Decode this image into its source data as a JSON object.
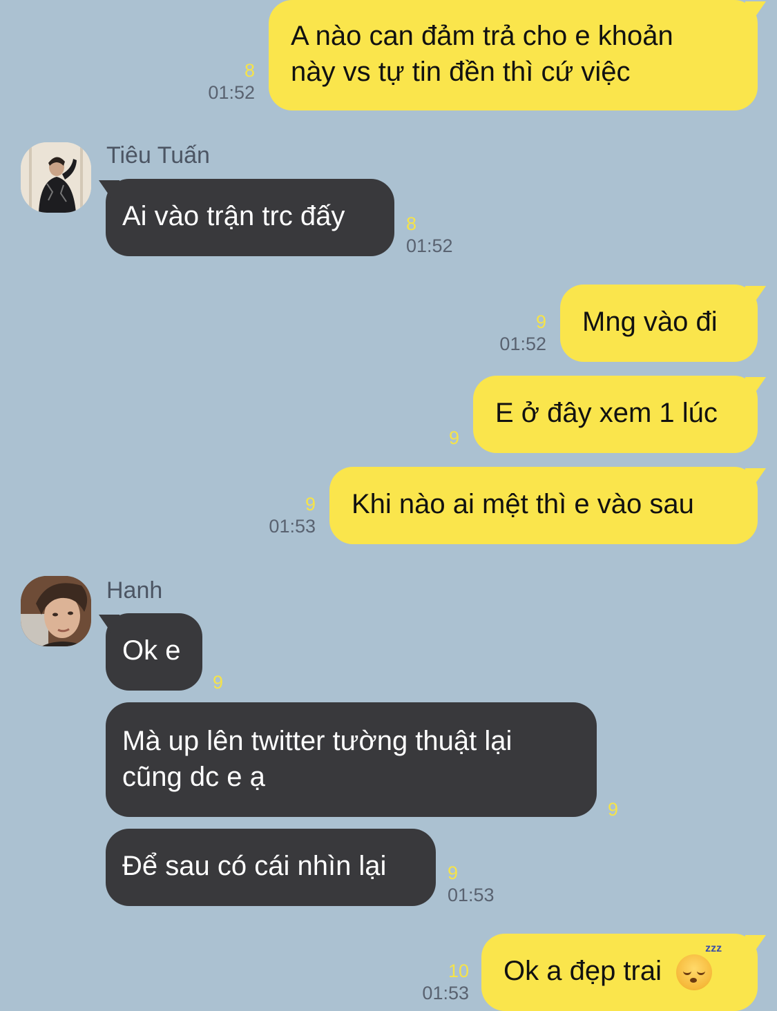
{
  "messages": [
    {
      "type": "out",
      "lines": [
        "A nào can đảm trả cho e khoản",
        "này vs tự tin đền thì cứ việc"
      ],
      "count": "8",
      "time": "01:52"
    },
    {
      "type": "in",
      "sender": "Tiêu Tuấn",
      "text": "Ai vào trận trc đấy",
      "count": "8",
      "time": "01:52"
    },
    {
      "type": "out",
      "text": "Mng vào đi",
      "count": "9",
      "time": "01:52"
    },
    {
      "type": "out",
      "text": "E ở đây xem 1 lúc",
      "count": "9"
    },
    {
      "type": "out",
      "text": "Khi nào ai mệt thì e vào sau",
      "count": "9",
      "time": "01:53"
    },
    {
      "type": "in",
      "sender": "Hanh",
      "text": "Ok e",
      "count": "9"
    },
    {
      "type": "in",
      "lines": [
        "Mà up lên twitter tường thuật lại",
        "cũng dc e ạ"
      ],
      "count": "9"
    },
    {
      "type": "in",
      "text": "Để sau có cái nhìn lại",
      "count": "9",
      "time": "01:53"
    },
    {
      "type": "out",
      "text": "Ok a đẹp trai",
      "emoji": "sleeping-face",
      "count": "10",
      "time": "01:53"
    }
  ],
  "emoji_zzz": "zzz",
  "colors": {
    "background": "#abc1d1",
    "outgoing_bubble": "#fae54c",
    "incoming_bubble": "#39393c",
    "unread_count": "#f5e34a",
    "timestamp": "#596270"
  }
}
